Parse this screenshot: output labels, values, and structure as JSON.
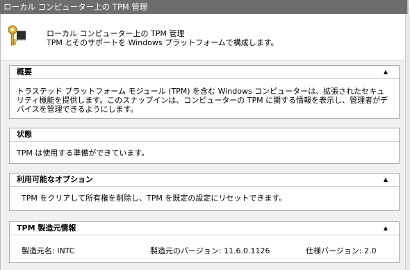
{
  "window": {
    "title": "ローカル コンピューター上の TPM 管理"
  },
  "header": {
    "title": "ローカル コンピューター上の TPM 管理",
    "subtitle": "TPM とそのサポートを Windows プラットフォームで構成します。",
    "icon": "key-chip-icon"
  },
  "sections": {
    "overview": {
      "title": "概要",
      "toggle": "▲",
      "body": "トラステッド プラットフォーム モジュール (TPM) を含む Windows コンピューターは、拡張されたセキュリティ機能を提供します。このスナップインは、コンピューターの TPM に関する情報を表示し、管理者がデバイスを管理できるようにします。"
    },
    "status": {
      "title": "状態",
      "body": "TPM は使用する準備ができています。"
    },
    "options": {
      "title": "利用可能なオプション",
      "toggle": "▲",
      "body": "TPM をクリアして所有権を削除し、TPM を既定の設定にリセットできます。"
    },
    "manufacturer": {
      "title": "TPM 製造元情報",
      "toggle": "▲",
      "name": "製造元名:  INTC",
      "version": "製造元のバージョン:  11.6.0.1126",
      "spec": "仕様バージョン:  2.0"
    }
  },
  "colors": {
    "titlebar": "#6d6d6d",
    "panel": "#f0f0f0",
    "border": "#a9a9a9"
  }
}
